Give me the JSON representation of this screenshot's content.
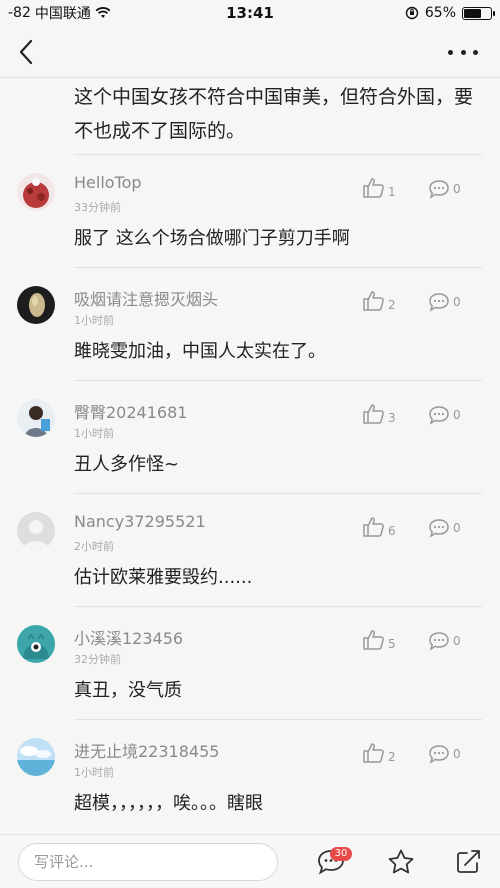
{
  "status_bar": {
    "signal": "-82",
    "carrier": "中国联通",
    "time": "13:41",
    "battery_percent": "65%",
    "battery_level": 0.65
  },
  "nav": {
    "back_icon": "chevron-left-icon",
    "more_icon": "more-dots-icon"
  },
  "first_comment_text": "这个中国女孩不符合中国审美，但符合外国，要不也成不了国际的。",
  "comments": [
    {
      "username": "HelloTop",
      "time": "33分钟前",
      "likes": "1",
      "replies": "0",
      "content": "服了 这么个场合做哪门子剪刀手啊",
      "avatar_color": "#b83a3a"
    },
    {
      "username": "吸烟请注意摁灭烟头",
      "time": "1小时前",
      "likes": "2",
      "replies": "0",
      "content": "雎晓雯加油，中国人太实在了。",
      "avatar_color": "#1d1d1d"
    },
    {
      "username": "臀臀20241681",
      "time": "1小时前",
      "likes": "3",
      "replies": "0",
      "content": "丑人多作怪~",
      "avatar_color": "#6e7a8a"
    },
    {
      "username": "Nancy37295521",
      "time": "2小时前",
      "likes": "6",
      "replies": "0",
      "content": "估计欧莱雅要毁约......",
      "avatar_color": "#d8d8d8"
    },
    {
      "username": "小溪溪123456",
      "time": "32分钟前",
      "likes": "5",
      "replies": "0",
      "content": "真丑，没气质",
      "avatar_color": "#3ea5a9"
    },
    {
      "username": "进无止境22318455",
      "time": "1小时前",
      "likes": "2",
      "replies": "0",
      "content": "超模，，，，，，唉。。。瞎眼",
      "avatar_color": "#8cc3e6"
    }
  ],
  "bottom_bar": {
    "input_placeholder": "写评论...",
    "comment_count_badge": "30",
    "comment_icon": "comment-bubble-icon",
    "favorite_icon": "star-icon",
    "share_icon": "share-icon"
  }
}
